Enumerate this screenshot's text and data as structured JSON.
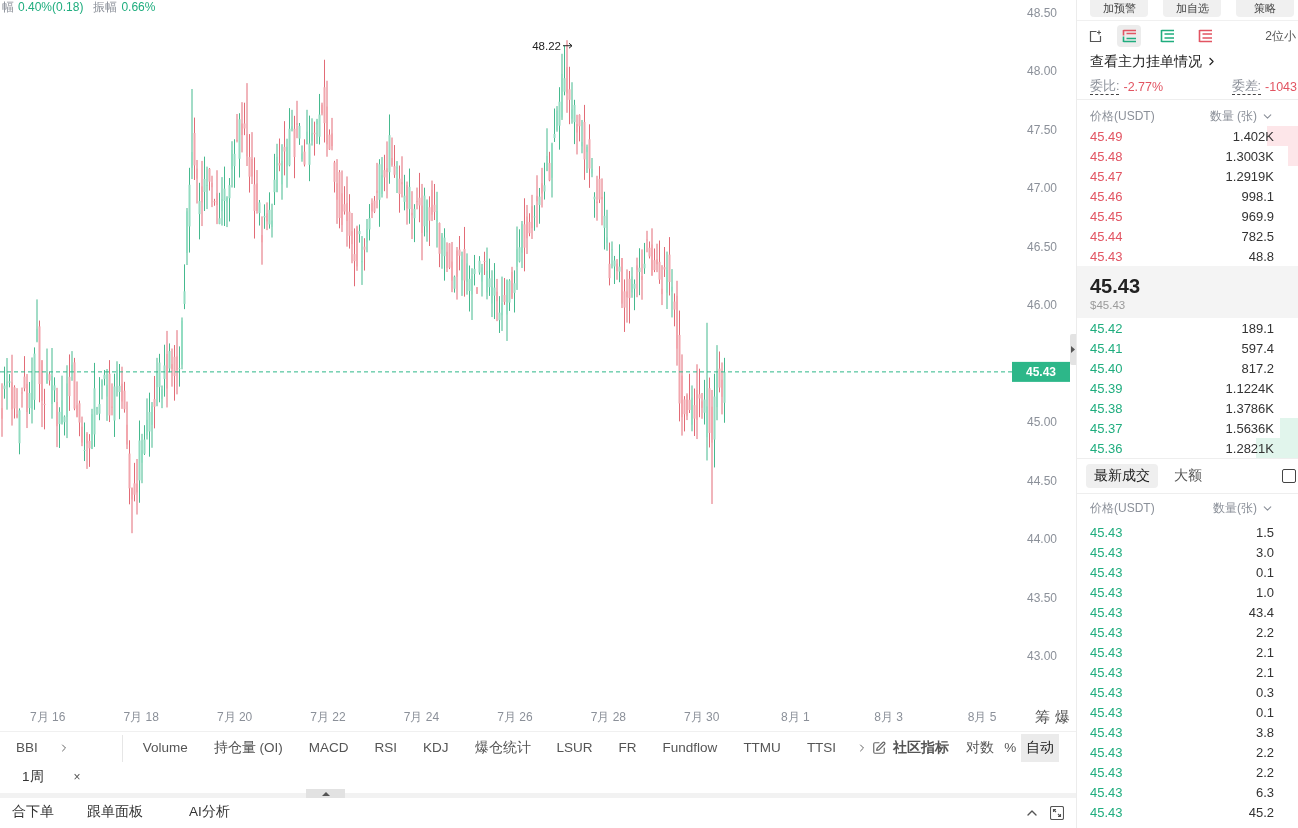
{
  "legend": [
    {
      "label": "幅",
      "value": "0.40%(0.18)"
    },
    {
      "label": "振幅",
      "value": "0.66%"
    }
  ],
  "chart": {
    "price_axis": [
      "48.50",
      "48.00",
      "47.50",
      "47.00",
      "46.50",
      "46.00",
      "45.00",
      "44.50",
      "44.00",
      "43.50",
      "43.00"
    ],
    "high_marker": "48.22",
    "current_price": "45.43",
    "date_axis": [
      "7月 16",
      "7月 18",
      "7月 20",
      "7月 22",
      "7月 24",
      "7月 26",
      "7月 28",
      "7月 30",
      "8月 1",
      "8月 3",
      "8月 5"
    ],
    "axis_buttons": [
      "筹",
      "爆"
    ]
  },
  "indicator_bar": {
    "main_indicator": "BBI",
    "sub_indicators": [
      {
        "label": "Volume",
        "selected": false
      },
      {
        "label": "持仓量 (OI)",
        "selected": false
      },
      {
        "label": "MACD",
        "selected": false
      },
      {
        "label": "RSI",
        "selected": false
      },
      {
        "label": "KDJ",
        "selected": false
      },
      {
        "label": "爆仓统计",
        "selected": false
      },
      {
        "label": "LSUR",
        "selected": false
      },
      {
        "label": "FR",
        "selected": false
      },
      {
        "label": "Fundflow",
        "selected": false
      },
      {
        "label": "TTMU",
        "selected": false
      },
      {
        "label": "TTSI",
        "selected": false
      }
    ],
    "community": "社区指标",
    "scale_modes": [
      {
        "label": "对数",
        "selected": false
      },
      {
        "label": "%",
        "selected": false
      },
      {
        "label": "自动",
        "selected": true
      }
    ]
  },
  "interval_tags": [
    {
      "label": "1周",
      "close": "×"
    }
  ],
  "bottom_tabs": [
    {
      "label": "合下单",
      "selected": false
    },
    {
      "label": "跟单面板",
      "selected": false
    },
    {
      "label": "AI分析",
      "selected": false
    }
  ],
  "order_panel": {
    "top_buttons": [
      "加预警",
      "加自选",
      "策略"
    ],
    "book_views": [
      {
        "kind": "both",
        "selected": true
      },
      {
        "kind": "bids",
        "selected": false
      },
      {
        "kind": "asks",
        "selected": false
      }
    ],
    "precision": "2位小",
    "main_orders_link": "查看主力挂单情况",
    "ratio": {
      "label": "委比:",
      "value": "-2.77%"
    },
    "difference": {
      "label": "委差:",
      "value": "-1043"
    },
    "book_header": {
      "price": "价格(USDT)",
      "amount": "数量 (张)"
    },
    "asks": [
      {
        "price": "45.49",
        "amount": "1.402K",
        "level": 0.14
      },
      {
        "price": "45.48",
        "amount": "1.3003K",
        "level": 0.045
      },
      {
        "price": "45.47",
        "amount": "1.2919K"
      },
      {
        "price": "45.46",
        "amount": "998.1"
      },
      {
        "price": "45.45",
        "amount": "969.9"
      },
      {
        "price": "45.44",
        "amount": "782.5"
      },
      {
        "price": "45.43",
        "amount": "48.8"
      }
    ],
    "last_price": "45.43",
    "last_price_usd": "$45.43",
    "bids": [
      {
        "price": "45.42",
        "amount": "189.1"
      },
      {
        "price": "45.41",
        "amount": "597.4"
      },
      {
        "price": "45.40",
        "amount": "817.2"
      },
      {
        "price": "45.39",
        "amount": "1.1224K"
      },
      {
        "price": "45.38",
        "amount": "1.3786K"
      },
      {
        "price": "45.37",
        "amount": "1.5636K",
        "level": 0.08
      },
      {
        "price": "45.36",
        "amount": "1.2821K",
        "level": 0.19
      }
    ],
    "trade_tabs": [
      {
        "label": "最新成交",
        "selected": true
      },
      {
        "label": "大额",
        "selected": false
      }
    ],
    "trade_filter": {
      "checked": false
    },
    "trades_header": {
      "price": "价格(USDT)",
      "amount": "数量(张)"
    },
    "trades": [
      {
        "price": "45.43",
        "amount": "1.5"
      },
      {
        "price": "45.43",
        "amount": "3.0"
      },
      {
        "price": "45.43",
        "amount": "0.1"
      },
      {
        "price": "45.43",
        "amount": "1.0"
      },
      {
        "price": "45.43",
        "amount": "43.4"
      },
      {
        "price": "45.43",
        "amount": "2.2"
      },
      {
        "price": "45.43",
        "amount": "2.1"
      },
      {
        "price": "45.43",
        "amount": "2.1"
      },
      {
        "price": "45.43",
        "amount": "0.3"
      },
      {
        "price": "45.43",
        "amount": "0.1"
      },
      {
        "price": "45.43",
        "amount": "3.8"
      },
      {
        "price": "45.43",
        "amount": "2.2"
      },
      {
        "price": "45.43",
        "amount": "2.2"
      },
      {
        "price": "45.43",
        "amount": "6.3"
      },
      {
        "price": "45.43",
        "amount": "45.2"
      }
    ]
  }
}
